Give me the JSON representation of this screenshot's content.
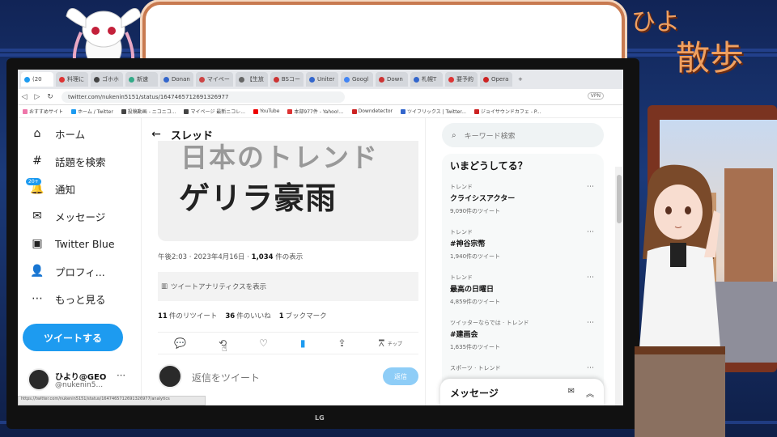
{
  "overlay": {
    "title_line1": "ひよ",
    "title_line2": "散歩"
  },
  "monitor": {
    "brand": "LG"
  },
  "browser": {
    "tabs": [
      {
        "label": "(20",
        "color": "#1d9bf0",
        "active": true
      },
      {
        "label": "料理に",
        "color": "#d33"
      },
      {
        "label": "ゴホホ",
        "color": "#444"
      },
      {
        "label": "新速",
        "color": "#3a8"
      },
      {
        "label": "Donan",
        "color": "#36c"
      },
      {
        "label": "マイペー",
        "color": "#c44"
      },
      {
        "label": "【生放",
        "color": "#666"
      },
      {
        "label": "BSコー",
        "color": "#c33"
      },
      {
        "label": "Uniter",
        "color": "#36c"
      },
      {
        "label": "Googl",
        "color": "#4285f4"
      },
      {
        "label": "Down",
        "color": "#c33"
      },
      {
        "label": "札幌T",
        "color": "#36c"
      },
      {
        "label": "要予約",
        "color": "#d33"
      },
      {
        "label": "Opera",
        "color": "#c22"
      }
    ],
    "url": "twitter.com/nukenin5151/status/1647465712691326977",
    "vpn_label": "VPN",
    "bookmarks": [
      {
        "label": "おすすめサイト",
        "color": "#e7a"
      },
      {
        "label": "ホーム / Twitter",
        "color": "#1d9bf0"
      },
      {
        "label": "投稿動画 - ニコニコ...",
        "color": "#444"
      },
      {
        "label": "マイページ 最新ニコレ...",
        "color": "#444"
      },
      {
        "label": "YouTube",
        "color": "#e00"
      },
      {
        "label": "本部977件 - Yahoo!...",
        "color": "#d33"
      },
      {
        "label": "Downdetector",
        "color": "#c22"
      },
      {
        "label": "ツイフリックス | Twitter...",
        "color": "#36c"
      },
      {
        "label": "ジョイサウンドカフェ - P...",
        "color": "#c22"
      }
    ],
    "status_url": "https://twitter.com/nukenin5151/status/1647465712691326977/analytics"
  },
  "sidebar": {
    "items": [
      {
        "label": "ホーム",
        "icon": "home-icon",
        "glyph": "⌂"
      },
      {
        "label": "話題を検索",
        "icon": "hash-icon",
        "glyph": "#"
      },
      {
        "label": "通知",
        "icon": "bell-icon",
        "glyph": "🔔"
      },
      {
        "label": "メッセージ",
        "icon": "mail-icon",
        "glyph": "✉"
      },
      {
        "label": "Twitter Blue",
        "icon": "twitter-blue-icon",
        "glyph": "▣"
      },
      {
        "label": "プロフィ...",
        "icon": "profile-icon",
        "glyph": "👤"
      },
      {
        "label": "もっと見る",
        "icon": "more-icon",
        "glyph": "⋯"
      }
    ],
    "notification_badge": "20+",
    "tweet_button": "ツイートする",
    "account": {
      "name": "ひより@GEO",
      "handle": "@nukenin5...",
      "more": "⋯"
    }
  },
  "main": {
    "title": "スレッド",
    "image_line1": "日本のトレンド",
    "image_line2": "ゲリラ豪雨",
    "meta_time": "午後2:03 · 2023年4月16日 · ",
    "meta_views": "1,034",
    "meta_views_suffix": " 件の表示",
    "analytics": "ツイートアナリティクスを表示",
    "retweets": "11",
    "retweets_label": "件のリツイート",
    "likes": "36",
    "likes_label": "件のいいね",
    "bookmarks": "1",
    "bookmarks_label": "ブックマーク",
    "tip_label": "チップ",
    "reply_placeholder": "返信をツイート",
    "reply_button": "返信"
  },
  "right": {
    "search_placeholder": "キーワード検索",
    "trends_title": "いまどうしてる？",
    "trends": [
      {
        "category": "トレンド",
        "name": "クライシスアクター",
        "count": "9,090件のツイート"
      },
      {
        "category": "トレンド",
        "name": "#神谷宗幣",
        "count": "1,940件のツイート"
      },
      {
        "category": "トレンド",
        "name": "最高の日曜日",
        "count": "4,859件のツイート"
      },
      {
        "category": "ツイッターならでは · トレンド",
        "name": "#建画会",
        "count": "1,635件のツイート"
      },
      {
        "category": "スポーツ · トレンド",
        "name": "",
        "count": ""
      }
    ],
    "messages_title": "メッセージ"
  }
}
